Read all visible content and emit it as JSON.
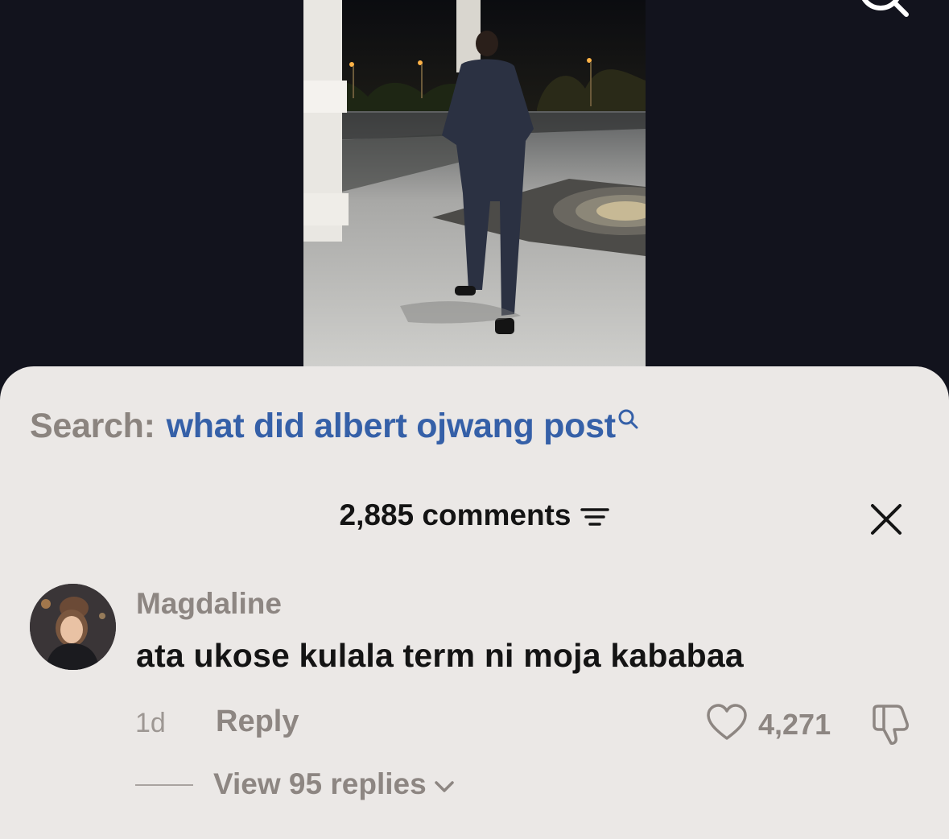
{
  "search": {
    "label": "Search:",
    "query": "what did albert ojwang post"
  },
  "comments": {
    "count_label": "2,885 comments"
  },
  "comment": {
    "username": "Magdaline",
    "text": "ata ukose kulala term ni moja kababaa",
    "time": "1d",
    "reply_label": "Reply",
    "like_count": "4,271",
    "view_replies_label": "View 95 replies"
  },
  "icons": {
    "top_search": "search-icon",
    "query_search": "search-icon",
    "filter": "filter-icon",
    "close": "close-icon",
    "like": "heart-icon",
    "dislike": "thumbs-down-icon",
    "expand": "chevron-down-icon"
  },
  "colors": {
    "sheet_bg": "#ebe8e6",
    "query_link": "#3560a8",
    "muted_text": "#8d8682",
    "primary_text": "#141414"
  }
}
